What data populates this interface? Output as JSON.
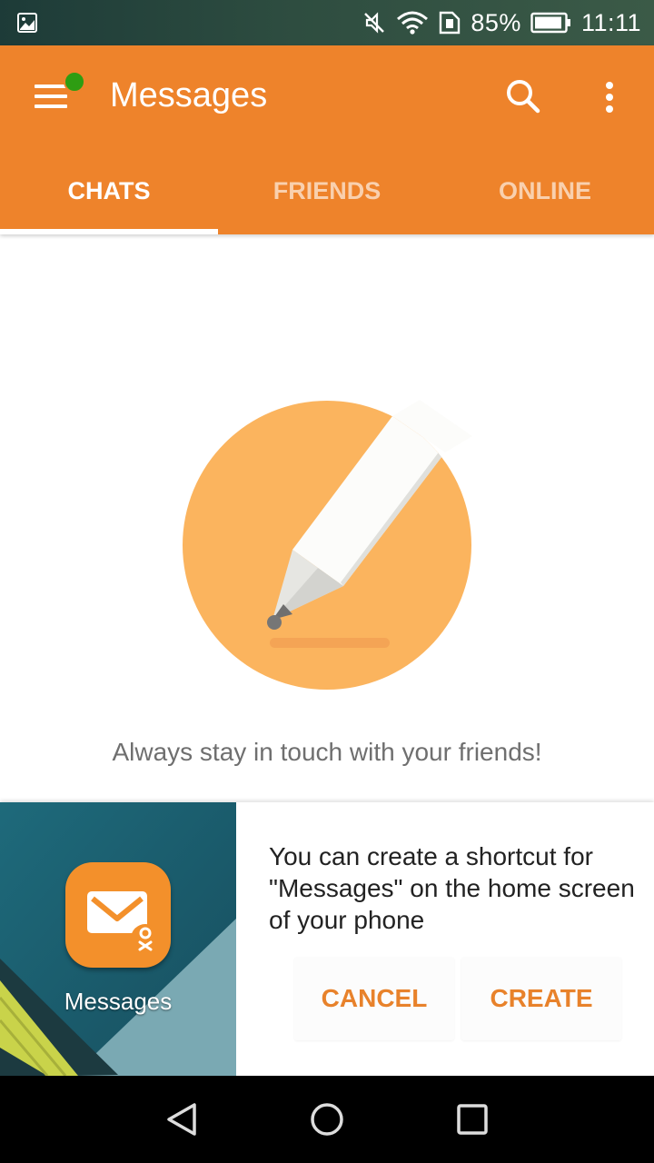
{
  "status_bar": {
    "battery": "85%",
    "time": "11:11",
    "icons": [
      "gallery-icon",
      "mute-icon",
      "wifi-icon",
      "sim-icon",
      "battery-icon"
    ]
  },
  "app_bar": {
    "title": "Messages",
    "icons": [
      "menu-icon",
      "search-icon",
      "more-vert-icon"
    ],
    "online_indicator_color": "#2e9d12"
  },
  "tabs": [
    {
      "label": "CHATS",
      "active": true
    },
    {
      "label": "FRIENDS",
      "active": false
    },
    {
      "label": "ONLINE",
      "active": false
    }
  ],
  "empty_state": {
    "icon": "pencil-illustration",
    "message": "Always stay in touch with your friends!"
  },
  "shortcut_banner": {
    "app_label": "Messages",
    "app_icon": "envelope-icon",
    "text": "You can create a shortcut for \"Messages\" on the home screen of your phone",
    "cancel_label": "CANCEL",
    "create_label": "CREATE"
  },
  "navigation_bar": {
    "icons": [
      "back-icon",
      "home-icon",
      "recents-icon"
    ]
  },
  "colors": {
    "accent": "#ee832b",
    "illustration_circle": "#fbb45e",
    "button_text": "#e8822b"
  }
}
